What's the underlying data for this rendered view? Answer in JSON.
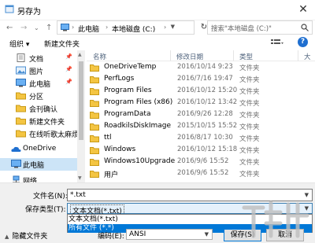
{
  "window": {
    "title": "另存为",
    "close_glyph": "✕"
  },
  "address": {
    "crumbs": [
      "此电脑",
      "本地磁盘 (C:)"
    ],
    "search_placeholder": "搜索\"本地磁盘 (C:)\""
  },
  "toolbar": {
    "organize": "组织 ▾",
    "new_folder": "新建文件夹",
    "help": "?"
  },
  "nav": {
    "items": [
      {
        "label": "文档",
        "icon": "documents-icon",
        "pinned": true
      },
      {
        "label": "图片",
        "icon": "pictures-icon",
        "pinned": true
      },
      {
        "label": "此电脑",
        "icon": "this-pc-icon",
        "pinned": true
      },
      {
        "label": "分区",
        "icon": "folder-icon",
        "pinned": false
      },
      {
        "label": "会刊确认",
        "icon": "folder-icon",
        "pinned": false
      },
      {
        "label": "新建文件夹",
        "icon": "folder-icon",
        "pinned": false
      },
      {
        "label": "在线听歌太麻烦",
        "icon": "folder-icon",
        "pinned": false
      },
      {
        "label": "OneDrive",
        "icon": "onedrive-icon",
        "pinned": false
      },
      {
        "label": "此电脑",
        "icon": "this-pc-icon",
        "pinned": false,
        "selected": true
      },
      {
        "label": "网络",
        "icon": "network-icon",
        "pinned": false
      }
    ]
  },
  "files": {
    "columns": {
      "name": "名称",
      "date": "修改日期",
      "type": "类型",
      "size": "大"
    },
    "rows": [
      {
        "name": "OneDriveTemp",
        "date": "2016/10/14 9:23",
        "type": "文件夹"
      },
      {
        "name": "PerfLogs",
        "date": "2016/7/16 19:47",
        "type": "文件夹"
      },
      {
        "name": "Program Files",
        "date": "2016/10/12 15:20",
        "type": "文件夹"
      },
      {
        "name": "Program Files (x86)",
        "date": "2016/10/12 13:42",
        "type": "文件夹"
      },
      {
        "name": "ProgramData",
        "date": "2016/9/26 12:28",
        "type": "文件夹"
      },
      {
        "name": "RoadkilsDiskImage",
        "date": "2015/10/15 15:52",
        "type": "文件夹"
      },
      {
        "name": "ttl",
        "date": "2016/8/17 10:30",
        "type": "文件夹"
      },
      {
        "name": "Windows",
        "date": "2016/10/12 15:18",
        "type": "文件夹"
      },
      {
        "name": "Windows10Upgrade",
        "date": "2016/9/6 15:52",
        "type": "文件夹"
      },
      {
        "name": "用户",
        "date": "2016/9/6 15:52",
        "type": "文件夹"
      }
    ]
  },
  "save": {
    "filename_label": "文件名(N):",
    "filename_value": "*.txt",
    "filetype_label": "保存类型(T):",
    "filetype_value": "文本文档(*.txt)",
    "filetype_options": [
      "文本文档(*.txt)",
      "所有文件 (*.*)"
    ],
    "selected_option_index": 1,
    "hide_folders": "隐藏文件夹",
    "encoding_label": "编码(E):",
    "encoding_value": "ANSI",
    "save_button": "保存(S)",
    "cancel_button": "取消"
  },
  "colors": {
    "accent": "#0078d7",
    "folder": "#f4c542",
    "selected_nav": "#cce4f7"
  }
}
